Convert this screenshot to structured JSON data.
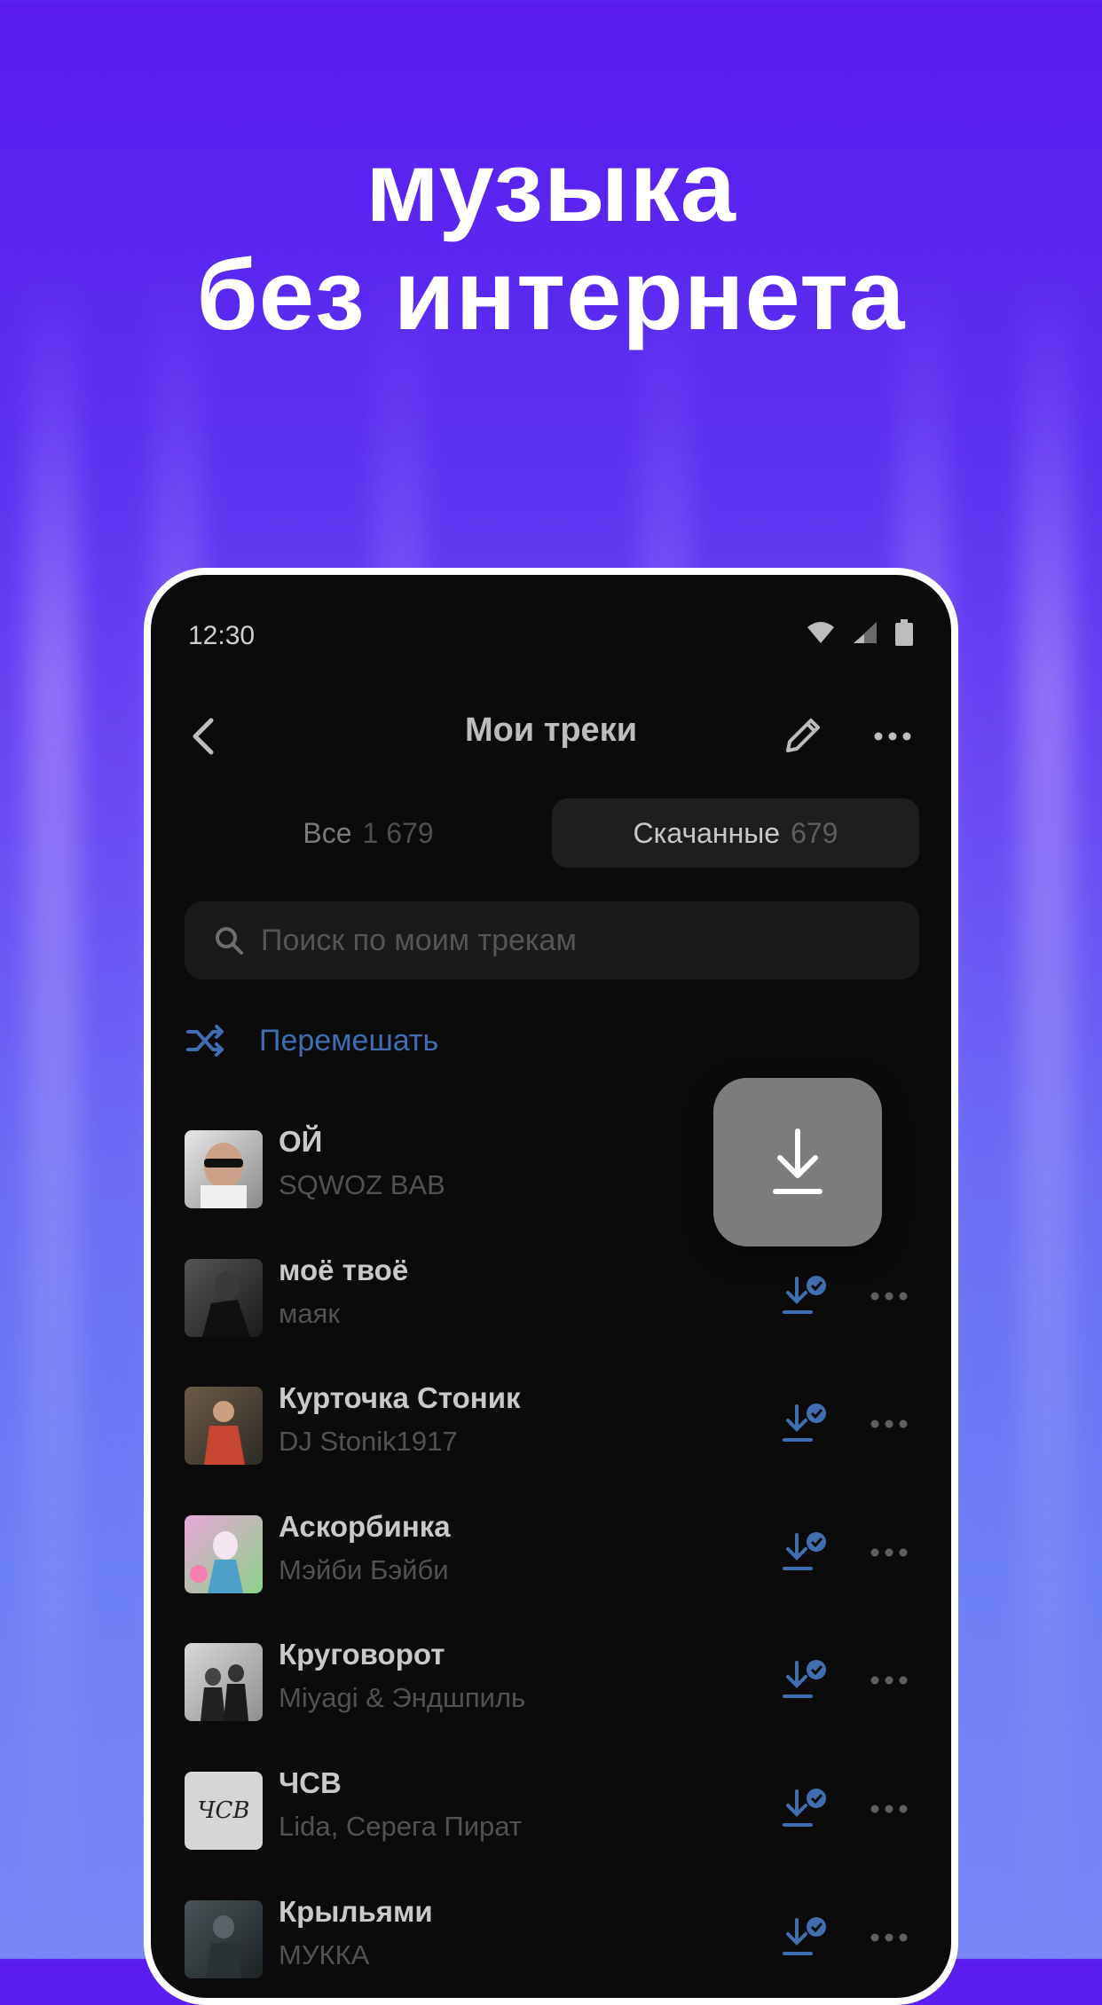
{
  "headline": {
    "line1": "музыка",
    "line2": "без интернета"
  },
  "status": {
    "time": "12:30"
  },
  "header": {
    "title": "Мои треки"
  },
  "tabs": [
    {
      "label": "Все",
      "count": "1 679"
    },
    {
      "label": "Скачанные",
      "count": "679"
    }
  ],
  "search": {
    "placeholder": "Поиск по моим трекам"
  },
  "shuffle": {
    "label": "Перемешать"
  },
  "tracks": [
    {
      "title": "ОЙ",
      "artist": "SQWOZ BAB"
    },
    {
      "title": "моё твоё",
      "artist": "маяк"
    },
    {
      "title": "Курточка Стоник",
      "artist": "DJ Stonik1917"
    },
    {
      "title": "Аскорбинка",
      "artist": "Мэйби Бэйби"
    },
    {
      "title": "Круговорот",
      "artist": "Miyagi & Эндшпиль"
    },
    {
      "title": "ЧСВ",
      "artist": "Lida, Серега Пират",
      "cover_text": "ЧСВ"
    },
    {
      "title": "Крыльями",
      "artist": "МУККА"
    }
  ],
  "colors": {
    "accent": "#3f6fb0",
    "background_top": "#5a1cf0",
    "phone_bg": "#0b0b0b"
  },
  "icons": [
    "back-arrow-icon",
    "edit-pencil-icon",
    "more-dots-icon",
    "search-icon",
    "shuffle-icon",
    "downloaded-check-icon",
    "download-arrow-icon",
    "wifi-icon",
    "signal-icon",
    "battery-icon"
  ]
}
